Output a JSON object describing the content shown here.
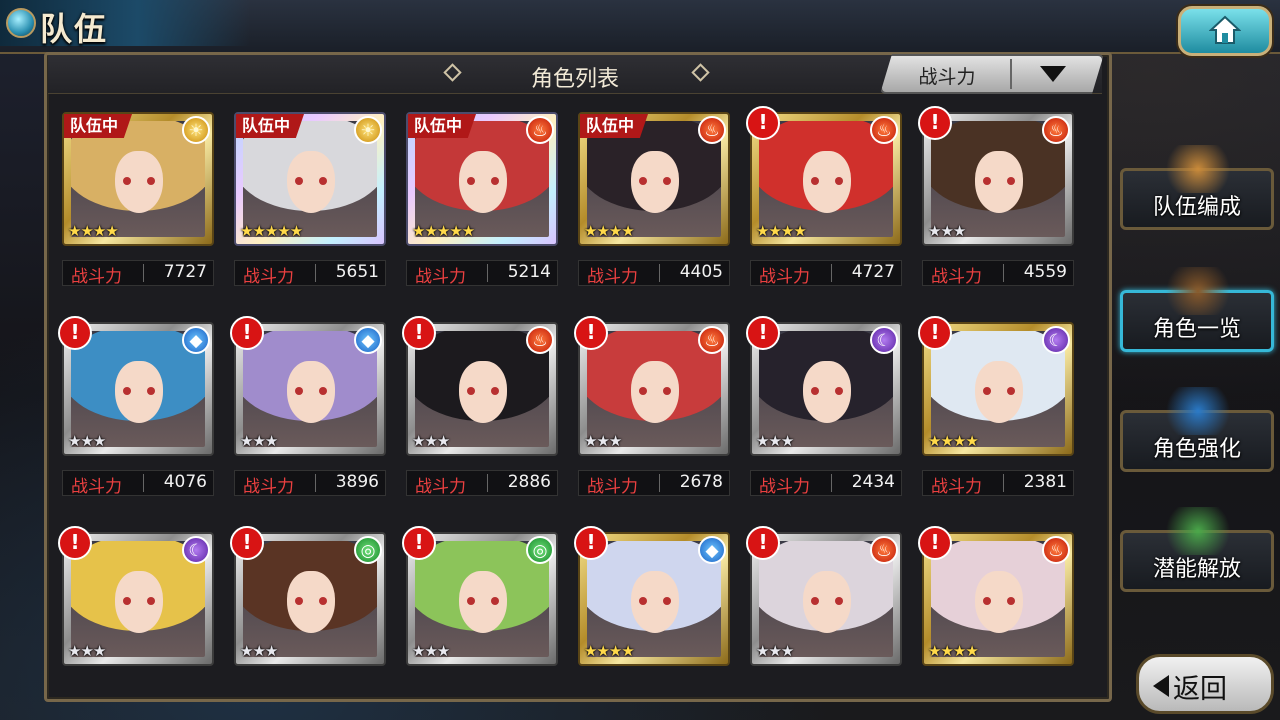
{
  "header": {
    "title": "队伍",
    "home_icon": "home-icon"
  },
  "list": {
    "title": "角色列表",
    "sort_label": "战斗力"
  },
  "power_label": "战斗力",
  "team_badge": "队伍中",
  "new_badge": "!",
  "characters": [
    {
      "frame": "gold",
      "element": "sun",
      "stars": 4,
      "in_team": true,
      "alert": false,
      "power": "7727",
      "hair": "#d8b064"
    },
    {
      "frame": "rainbow",
      "element": "sun",
      "stars": 5,
      "in_team": true,
      "alert": false,
      "power": "5651",
      "hair": "#d8d8dc"
    },
    {
      "frame": "rainbow",
      "element": "fire",
      "stars": 5,
      "in_team": true,
      "alert": false,
      "power": "5214",
      "hair": "#c43838"
    },
    {
      "frame": "gold",
      "element": "fire",
      "stars": 4,
      "in_team": true,
      "alert": false,
      "power": "4405",
      "hair": "#2a2228"
    },
    {
      "frame": "gold",
      "element": "fire",
      "stars": 4,
      "in_team": false,
      "alert": true,
      "power": "4727",
      "hair": "#d0302c"
    },
    {
      "frame": "silver",
      "element": "fire",
      "stars": 3,
      "in_team": false,
      "alert": true,
      "power": "4559",
      "hair": "#4a3224"
    },
    {
      "frame": "silver",
      "element": "water",
      "stars": 3,
      "in_team": false,
      "alert": true,
      "power": "4076",
      "hair": "#3d8ec4"
    },
    {
      "frame": "silver",
      "element": "water",
      "stars": 3,
      "in_team": false,
      "alert": true,
      "power": "3896",
      "hair": "#a08ccc"
    },
    {
      "frame": "silver",
      "element": "fire",
      "stars": 3,
      "in_team": false,
      "alert": true,
      "power": "2886",
      "hair": "#1c1a1e"
    },
    {
      "frame": "silver",
      "element": "fire",
      "stars": 3,
      "in_team": false,
      "alert": true,
      "power": "2678",
      "hair": "#c83c3c"
    },
    {
      "frame": "silver",
      "element": "moon",
      "stars": 3,
      "in_team": false,
      "alert": true,
      "power": "2434",
      "hair": "#26222c"
    },
    {
      "frame": "gold",
      "element": "moon",
      "stars": 4,
      "in_team": false,
      "alert": true,
      "power": "2381",
      "hair": "#dfe8f2"
    },
    {
      "frame": "silver",
      "element": "moon",
      "stars": 3,
      "in_team": false,
      "alert": true,
      "power": "",
      "hair": "#e6c24a"
    },
    {
      "frame": "silver",
      "element": "wind",
      "stars": 3,
      "in_team": false,
      "alert": true,
      "power": "",
      "hair": "#5a3424"
    },
    {
      "frame": "silver",
      "element": "wind",
      "stars": 3,
      "in_team": false,
      "alert": true,
      "power": "",
      "hair": "#8cc45a"
    },
    {
      "frame": "gold",
      "element": "water",
      "stars": 4,
      "in_team": false,
      "alert": true,
      "power": "",
      "hair": "#cfd6ee"
    },
    {
      "frame": "silver",
      "element": "fire",
      "stars": 3,
      "in_team": false,
      "alert": true,
      "power": "",
      "hair": "#dcd4dc"
    },
    {
      "frame": "gold",
      "element": "fire",
      "stars": 4,
      "in_team": false,
      "alert": true,
      "power": "",
      "hair": "#e6d0d8"
    }
  ],
  "side_menu": [
    {
      "label": "队伍编成",
      "active": false,
      "art": "#c98a3a"
    },
    {
      "label": "角色一览",
      "active": true,
      "art": "#8a5a2a"
    },
    {
      "label": "角色强化",
      "active": false,
      "art": "#2a7ac8"
    },
    {
      "label": "潜能解放",
      "active": false,
      "art": "#4aa84a"
    }
  ],
  "back_label": "返回",
  "element_glyphs": {
    "sun": "☀",
    "fire": "♨",
    "water": "◆",
    "moon": "☾",
    "wind": "◎"
  }
}
